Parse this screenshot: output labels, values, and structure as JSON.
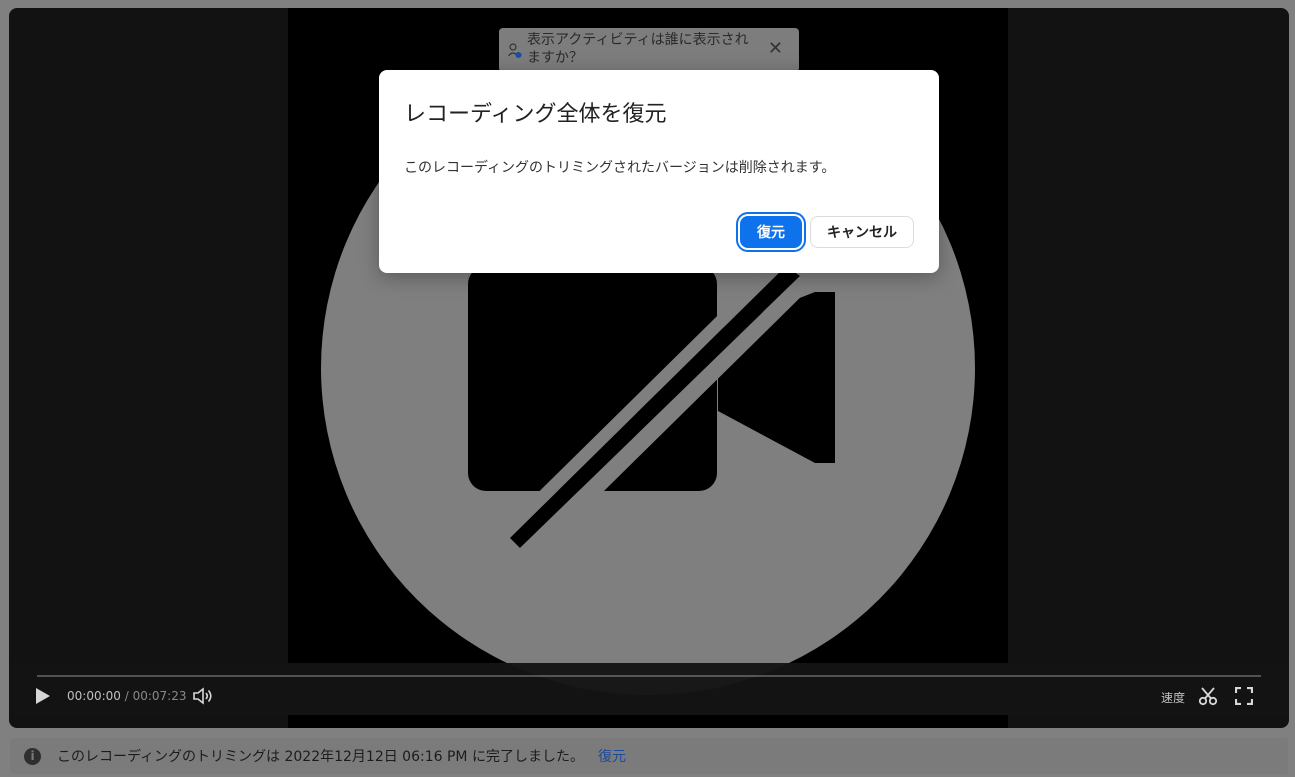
{
  "notice": {
    "text": "表示アクティビティは誰に表示されますか？",
    "close_glyph": "✕"
  },
  "controls": {
    "current_time": "00:00:00",
    "separator": " / ",
    "total_time": "00:07:23",
    "speed_label": "速度",
    "progress": 0
  },
  "status": {
    "info_glyph": "i",
    "message": "このレコーディングのトリミングは 2022年12月12日 06:16 PM に完了しました。",
    "link_label": "復元"
  },
  "modal": {
    "title": "レコーディング全体を復元",
    "body": "このレコーディングのトリミングされたバージョンは削除されます。",
    "confirm_label": "復元",
    "cancel_label": "キャンセル"
  },
  "colors": {
    "accent": "#0e72ed",
    "overlay": "#808080",
    "player_bg": "#121212"
  },
  "icons": {
    "notice": "user-visibility-icon",
    "close": "close-icon",
    "video_off": "video-off-icon",
    "play": "play-icon",
    "volume": "volume-icon",
    "trim": "scissors-icon",
    "fullscreen": "fullscreen-icon",
    "info": "info-icon"
  }
}
